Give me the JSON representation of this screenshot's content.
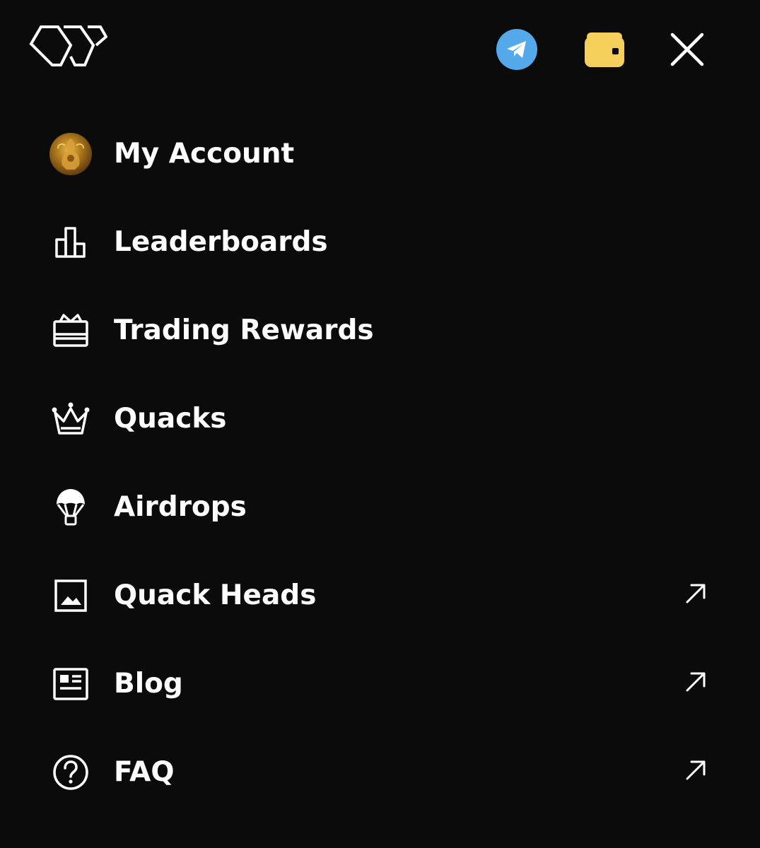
{
  "header": {
    "logo": "wp-logo",
    "buttons": [
      {
        "name": "telegram",
        "icon": "telegram-icon",
        "color": "#54a9eb"
      },
      {
        "name": "wallet",
        "icon": "wallet-icon",
        "color": "#f5cf5b"
      },
      {
        "name": "close",
        "icon": "close-icon"
      }
    ]
  },
  "menu": {
    "items": [
      {
        "label": "My Account",
        "icon": "avatar",
        "external": false
      },
      {
        "label": "Leaderboards",
        "icon": "bar-chart-icon",
        "external": false
      },
      {
        "label": "Trading Rewards",
        "icon": "gift-card-icon",
        "external": false
      },
      {
        "label": "Quacks",
        "icon": "crown-icon",
        "external": false
      },
      {
        "label": "Airdrops",
        "icon": "parachute-icon",
        "external": false
      },
      {
        "label": "Quack Heads",
        "icon": "image-icon",
        "external": true
      },
      {
        "label": "Blog",
        "icon": "newspaper-icon",
        "external": true
      },
      {
        "label": "FAQ",
        "icon": "question-circle-icon",
        "external": true
      }
    ]
  },
  "colors": {
    "background": "#0b0b0b",
    "text": "#ffffff",
    "telegram": "#54a9eb",
    "wallet": "#f5cf5b"
  }
}
